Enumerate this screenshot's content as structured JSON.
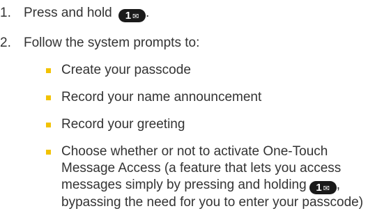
{
  "steps": [
    {
      "num": "1.",
      "text": "Press and hold",
      "suffix": "."
    },
    {
      "num": "2.",
      "text": "Follow the system prompts to:"
    }
  ],
  "key": {
    "label": "1",
    "icon": "envelope-icon",
    "glyph": "✉"
  },
  "bullets": [
    {
      "text": "Create your passcode"
    },
    {
      "text": "Record your name announcement"
    },
    {
      "text": "Record your greeting"
    }
  ],
  "long_bullet": {
    "line1": "Choose whether or not to activate One-Touch",
    "line2": "Message Access (a feature that lets you access",
    "line3a": "messages simply by pressing and holding",
    "line3b": ",",
    "line4": "bypassing the need for you to enter your passcode)"
  },
  "colors": {
    "bullet": "#f2c200",
    "text": "#333333",
    "key_bg": "#1a1a1a"
  }
}
